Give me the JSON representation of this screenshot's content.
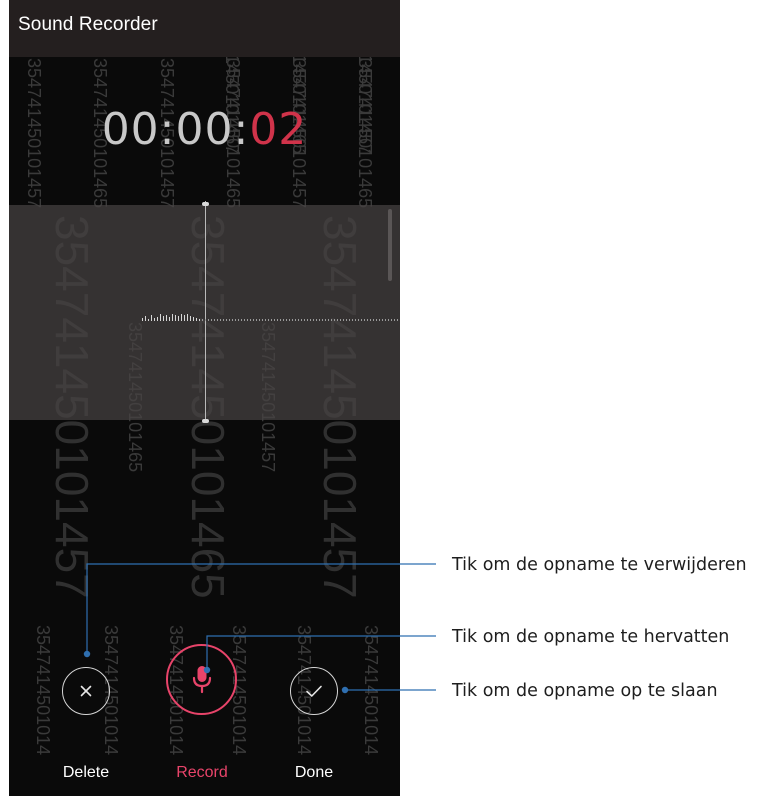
{
  "app": {
    "title": "Sound Recorder"
  },
  "timer": {
    "prefix": "00:00:",
    "seconds": "02"
  },
  "watermark": {
    "texts": [
      "354741450101457",
      "354741450101465",
      "3547414501014"
    ],
    "color": "#3a3a3a"
  },
  "controls": {
    "delete": {
      "label": "Delete"
    },
    "record": {
      "label": "Record"
    },
    "done": {
      "label": "Done"
    }
  },
  "callouts": {
    "delete": "Tik om de opname te verwijderen",
    "resume": "Tik om de opname te hervatten",
    "save": "Tik om de opname op te slaan"
  },
  "icons": {
    "delete": "close-icon",
    "record": "microphone-icon",
    "done": "checkmark-icon"
  },
  "colors": {
    "accent": "#e8446a",
    "timer_seconds": "#d0334a",
    "callout_line": "#2f6fb0",
    "title_bar": "#241f1f",
    "background": "#0a0a0a"
  }
}
